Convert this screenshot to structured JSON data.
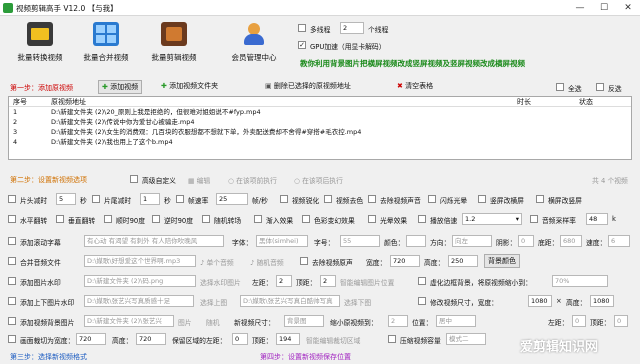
{
  "window": {
    "title": "视频剪辑高手 V12.0 【与我】",
    "minimize": "—",
    "maximize": "☐",
    "close": "✕"
  },
  "toolbar": {
    "items": [
      {
        "label": "批量转换视频",
        "icon": "film-convert-icon"
      },
      {
        "label": "批量合并视频",
        "icon": "merge-grid-icon"
      },
      {
        "label": "批量剪辑视频",
        "icon": "film-cut-icon"
      },
      {
        "label": "会员管理中心",
        "icon": "member-icon"
      }
    ],
    "multithread_label": "多线程",
    "thread_count": "2",
    "thread_unit": "个线程",
    "gpu_label": "GPU加速（用显卡解码）",
    "banner": "教你利用背景图片把横屏视频改成竖屏视频及竖屏视频改成横屏视频"
  },
  "step1": {
    "title": "第一步：添加原视频",
    "add_video": "添加视频",
    "add_folder": "添加视频文件夹",
    "delete_selected": "删除已选择的原视频地址",
    "clear": "清空表格",
    "select_all": "全选",
    "invert": "反选"
  },
  "table": {
    "headers": [
      "序号",
      "原视频地址",
      "时长",
      "状态"
    ],
    "rows": [
      [
        "1",
        "D:\\新建文件夹 (2)\\20_原则上我是拒绝的，但很难对姐姐说不#fyp.mp4"
      ],
      [
        "2",
        "D:\\新建文件夹 (2)\\传说中你为爱甘心被骗走.mp4"
      ],
      [
        "3",
        "D:\\新建文件夹 (2)\\女生的消费观：几百块的衣服想都不想就下单，外卖配送费却不舍得#穿搭#毛衣控.mp4"
      ],
      [
        "4",
        "D:\\新建文件夹 (2)\\我也用上了这个b.mp4"
      ]
    ]
  },
  "step2": {
    "title": "第二步：设置新视频选项",
    "advanced": "高级自定义",
    "edit": "编辑",
    "exec_before": "在该项前执行",
    "exec_after": "在该项后执行",
    "total": "共 4 个视频"
  },
  "options": {
    "row1": {
      "cut_head": "片头减时",
      "cut_head_val": "5",
      "sec1": "秒",
      "cut_tail": "片尾减时",
      "cut_tail_val": "1",
      "sec2": "秒",
      "frame_rate": "帧速率",
      "frame_val": "25",
      "fps": "帧/秒",
      "sharpen": "视频锐化",
      "color_adj": "视频去色",
      "remove_audio": "去除视频声音",
      "flash": "闪烁光晕",
      "vertical_blur": "竖屏改横屏",
      "horizontal_blur": "横屏改竖屏"
    },
    "row2": {
      "hflip": "水平翻转",
      "vflip": "垂直翻转",
      "rot90cw": "顺时90度",
      "rot90ccw": "逆时90度",
      "random": "随机转场",
      "fade": "渐入效果",
      "stat": "色彩变幻效果",
      "light": "光晕效果",
      "speed": "播放倍速",
      "speed_val": "1.2",
      "sample": "音频采样率",
      "sample_val": "48",
      "k": "k"
    },
    "row3": {
      "scroll": "添加滚动字幕",
      "scroll_text": "有心动 有渴望 有刺外 有人陪你吹晚风",
      "font": "字体：",
      "font_val": "黑体(simhei)",
      "size": "字号：",
      "size_val": "55",
      "color": "颜色：",
      "dir": "方向：",
      "dir_val": "向左",
      "shadow": "阴影：",
      "shadow_val": "0",
      "bottom": "底距：",
      "bottom_val": "680",
      "speed": "速度：",
      "speed_val": "6"
    },
    "row4": {
      "merge_audio": "合并音频文件",
      "audio_path": "D:\\媒歌\\好想爱这个世界啊.mp3",
      "single_audio": "单个音频",
      "random_audio": "随机音频",
      "remove_orig": "去除视频原声",
      "width": "宽度：",
      "width_val": "720",
      "height": "高度：",
      "height_val": "250",
      "bgcolor": "背景颜色"
    },
    "row5": {
      "watermark": "添加图片水印",
      "wm_path": "D:\\新建文件夹 (2)\\码.png",
      "select_wm": "选择水印图片",
      "left": "左距：",
      "left_val": "2",
      "top": "顶距：",
      "top_val": "2",
      "smart": "智能编辑图片位置",
      "virtual_border": "虚化边框背景，将原视频缩小到：",
      "shrink_val": "70%"
    },
    "row6": {
      "head_tail": "添加上下图片水印",
      "top_path": "D:\\媒歌\\张艺兴写真质感十足",
      "sel_top": "选择上图",
      "bot_path": "D:\\媒歌\\张艺兴写真白酷帅写真",
      "sel_bottom": "选择下图",
      "modify_w": "修改视频尺寸，宽度：",
      "mw_val": "1080",
      "x": "×",
      "modify_h": "高度：",
      "mh_val": "1080"
    },
    "row7": {
      "bg_add": "添加视频背景图片",
      "bg_path": "D:\\新建文件夹 (2)\\张艺兴",
      "pic": "图片",
      "random_bg": "随机",
      "new_size": "新视频尺寸：",
      "new_size_val": "背景图",
      "shrink_to": "缩小原视频到：",
      "shrink_to_val": "2",
      "location": "位置：",
      "location_val": "居中",
      "left_pos": "左距：",
      "left_pos_val": "0",
      "top_pos": "顶距：",
      "top_pos_val": "0"
    },
    "row8": {
      "crop": "画面裁切为宽度：",
      "crop_w": "720",
      "crop_h_lbl": "高度：",
      "crop_h": "720",
      "keep": "保留区域的左距：",
      "keep_left": "0",
      "keep_top_lbl": "顶距：",
      "keep_top": "194",
      "smart_cut": "智能编辑裁切区域",
      "compress": "压缩视频容量",
      "mode": "模式二"
    }
  },
  "step3": {
    "title": "第三步：选择新视频格式"
  },
  "step4": {
    "title": "第四步：设置新视频保存位置"
  },
  "watermark": "爱剪辑知识网"
}
